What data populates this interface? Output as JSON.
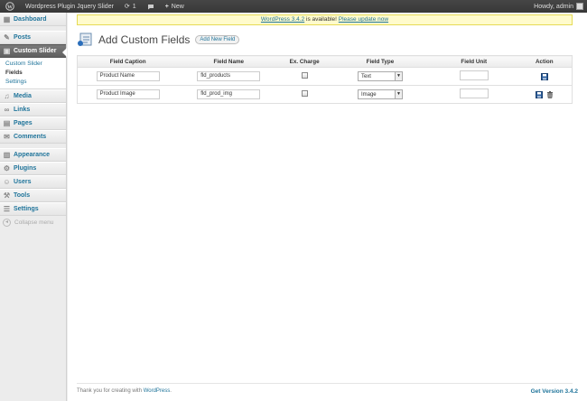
{
  "adminbar": {
    "site_name": "Wordpress Plugin Jquery Slider",
    "updates_count": "1",
    "new_label": "New",
    "howdy": "Howdy, admin"
  },
  "sidebar": {
    "items": [
      {
        "label": "Dashboard",
        "icon": "dashboard-icon"
      },
      {
        "label": "Posts",
        "icon": "posts-icon"
      },
      {
        "label": "Custom Slider",
        "icon": "slider-icon"
      },
      {
        "label": "Media",
        "icon": "media-icon"
      },
      {
        "label": "Links",
        "icon": "links-icon"
      },
      {
        "label": "Pages",
        "icon": "pages-icon"
      },
      {
        "label": "Comments",
        "icon": "comments-icon"
      },
      {
        "label": "Appearance",
        "icon": "appearance-icon"
      },
      {
        "label": "Plugins",
        "icon": "plugins-icon"
      },
      {
        "label": "Users",
        "icon": "users-icon"
      },
      {
        "label": "Tools",
        "icon": "tools-icon"
      },
      {
        "label": "Settings",
        "icon": "settings-icon"
      }
    ],
    "submenu": [
      "Custom Slider",
      "Fields",
      "Settings"
    ],
    "collapse": "Collapse menu"
  },
  "notice": {
    "version_link": "WordPress 3.4.2",
    "middle": " is available! ",
    "update_link": "Please update now"
  },
  "page": {
    "title": "Add Custom Fields",
    "add_new": "Add New Field"
  },
  "table": {
    "headers": [
      "Field Caption",
      "Field Name",
      "Ex. Charge",
      "Field Type",
      "Field Unit",
      "Action"
    ],
    "rows": [
      {
        "caption": "Product Name",
        "name": "fld_products",
        "charge": false,
        "type": "Text",
        "unit": "",
        "actions": [
          "save-icon"
        ]
      },
      {
        "caption": "Product Image",
        "name": "fld_prod_img",
        "charge": false,
        "type": "Image",
        "unit": "",
        "actions": [
          "save-icon",
          "trash-icon"
        ]
      }
    ]
  },
  "footer": {
    "thanks_prefix": "Thank you for creating with ",
    "wp_link": "WordPress",
    "thanks_suffix": ".",
    "version": "Get Version 3.4.2"
  },
  "colors": {
    "link": "#21759b",
    "notice_bg": "#fffbcc",
    "adminbar": "#464646"
  }
}
